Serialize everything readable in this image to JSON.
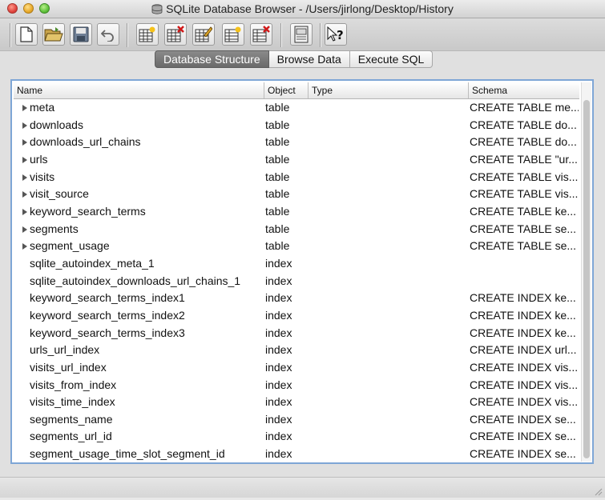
{
  "window": {
    "title": "SQLite Database Browser - /Users/jirlong/Desktop/History"
  },
  "toolbar": {
    "buttons": [
      {
        "icon": "new-document-icon"
      },
      {
        "icon": "open-folder-icon"
      },
      {
        "icon": "save-disk-icon"
      },
      {
        "icon": "undo-arrow-icon"
      },
      {
        "icon": "create-table-icon"
      },
      {
        "icon": "delete-table-icon"
      },
      {
        "icon": "modify-table-icon"
      },
      {
        "icon": "create-index-icon"
      },
      {
        "icon": "delete-index-icon"
      },
      {
        "icon": "log-window-icon"
      },
      {
        "icon": "whats-this-help-icon"
      }
    ]
  },
  "tabs": [
    {
      "label": "Database Structure",
      "active": true
    },
    {
      "label": "Browse Data",
      "active": false
    },
    {
      "label": "Execute SQL",
      "active": false
    }
  ],
  "table": {
    "columns": [
      "Name",
      "Object",
      "Type",
      "Schema"
    ],
    "rows": [
      {
        "name": "meta",
        "object": "table",
        "type": "",
        "schema": "CREATE TABLE me...",
        "expandable": true
      },
      {
        "name": "downloads",
        "object": "table",
        "type": "",
        "schema": "CREATE TABLE do...",
        "expandable": true
      },
      {
        "name": "downloads_url_chains",
        "object": "table",
        "type": "",
        "schema": "CREATE TABLE do...",
        "expandable": true
      },
      {
        "name": "urls",
        "object": "table",
        "type": "",
        "schema": "CREATE TABLE \"ur...",
        "expandable": true
      },
      {
        "name": "visits",
        "object": "table",
        "type": "",
        "schema": "CREATE TABLE vis...",
        "expandable": true
      },
      {
        "name": "visit_source",
        "object": "table",
        "type": "",
        "schema": "CREATE TABLE vis...",
        "expandable": true
      },
      {
        "name": "keyword_search_terms",
        "object": "table",
        "type": "",
        "schema": "CREATE TABLE ke...",
        "expandable": true
      },
      {
        "name": "segments",
        "object": "table",
        "type": "",
        "schema": "CREATE TABLE se...",
        "expandable": true
      },
      {
        "name": "segment_usage",
        "object": "table",
        "type": "",
        "schema": "CREATE TABLE se...",
        "expandable": true
      },
      {
        "name": "sqlite_autoindex_meta_1",
        "object": "index",
        "type": "",
        "schema": "",
        "expandable": false
      },
      {
        "name": "sqlite_autoindex_downloads_url_chains_1",
        "object": "index",
        "type": "",
        "schema": "",
        "expandable": false
      },
      {
        "name": "keyword_search_terms_index1",
        "object": "index",
        "type": "",
        "schema": "CREATE INDEX ke...",
        "expandable": false
      },
      {
        "name": "keyword_search_terms_index2",
        "object": "index",
        "type": "",
        "schema": "CREATE INDEX ke...",
        "expandable": false
      },
      {
        "name": "keyword_search_terms_index3",
        "object": "index",
        "type": "",
        "schema": "CREATE INDEX ke...",
        "expandable": false
      },
      {
        "name": "urls_url_index",
        "object": "index",
        "type": "",
        "schema": "CREATE INDEX url...",
        "expandable": false
      },
      {
        "name": "visits_url_index",
        "object": "index",
        "type": "",
        "schema": "CREATE INDEX vis...",
        "expandable": false
      },
      {
        "name": "visits_from_index",
        "object": "index",
        "type": "",
        "schema": "CREATE INDEX vis...",
        "expandable": false
      },
      {
        "name": "visits_time_index",
        "object": "index",
        "type": "",
        "schema": "CREATE INDEX vis...",
        "expandable": false
      },
      {
        "name": "segments_name",
        "object": "index",
        "type": "",
        "schema": "CREATE INDEX se...",
        "expandable": false
      },
      {
        "name": "segments_url_id",
        "object": "index",
        "type": "",
        "schema": "CREATE INDEX se...",
        "expandable": false
      },
      {
        "name": "segment_usage_time_slot_segment_id",
        "object": "index",
        "type": "",
        "schema": "CREATE INDEX se...",
        "expandable": false
      }
    ]
  },
  "colors": {
    "panel_focus_border": "#7ea6d6",
    "active_tab": "#6a6a6a"
  }
}
